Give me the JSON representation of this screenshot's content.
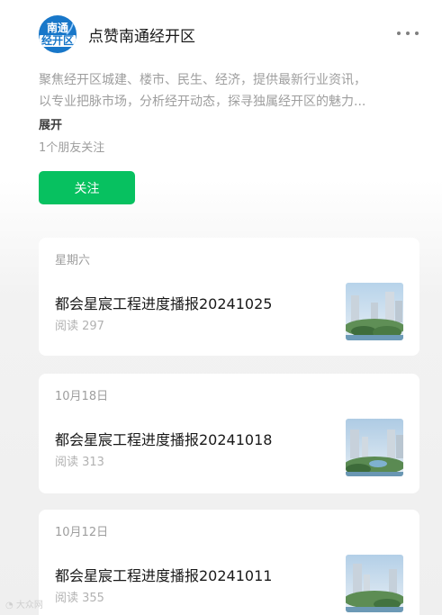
{
  "account": {
    "name": "点赞南通经开区",
    "logo_text_line1": "南通",
    "logo_text_line2": "经开区",
    "description_line1": "聚焦经开区城建、楼市、民生、经济，提供最新行业资讯，",
    "description_line2": "以专业把脉市场，分析经开动态，探寻独属经开区的魅力...",
    "expand_label": "展开",
    "friends_following": "1个朋友关注",
    "follow_label": "关注"
  },
  "articles": [
    {
      "date": "星期六",
      "title": "都会星宸工程进度播报20241025",
      "reads": "阅读 297"
    },
    {
      "date": "10月18日",
      "title": "都会星宸工程进度播报20241018",
      "reads": "阅读 313"
    },
    {
      "date": "10月12日",
      "title": "都会星宸工程进度播报20241011",
      "reads": "阅读 355"
    }
  ],
  "watermark": "大众网",
  "colors": {
    "follow_button": "#07c160",
    "logo_blue": "#1877c9",
    "secondary_text": "#9e9e9e"
  }
}
